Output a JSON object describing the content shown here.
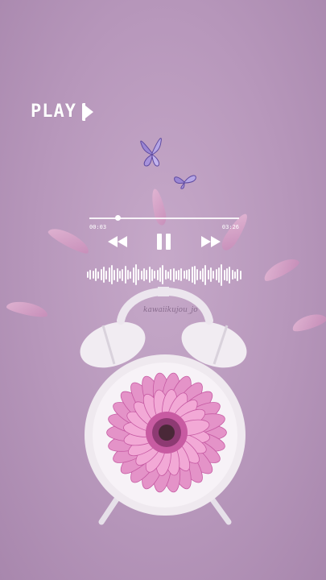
{
  "play_label": "PLAY",
  "icons": {
    "play": "play-icon",
    "rewind": "rewind-icon",
    "pause": "pause-icon",
    "forward": "fast-forward-icon",
    "butterfly": "butterfly-icon"
  },
  "player": {
    "elapsed": "00:03",
    "duration": "03:26",
    "progress": 0.17
  },
  "watermark": "kawaiikujou_jo",
  "colors": {
    "background": "#b797bb",
    "controls": "#ffffff",
    "flower_petals": "#e493c8",
    "flower_center": "#4a2838",
    "clock_body": "#efe9ef"
  }
}
